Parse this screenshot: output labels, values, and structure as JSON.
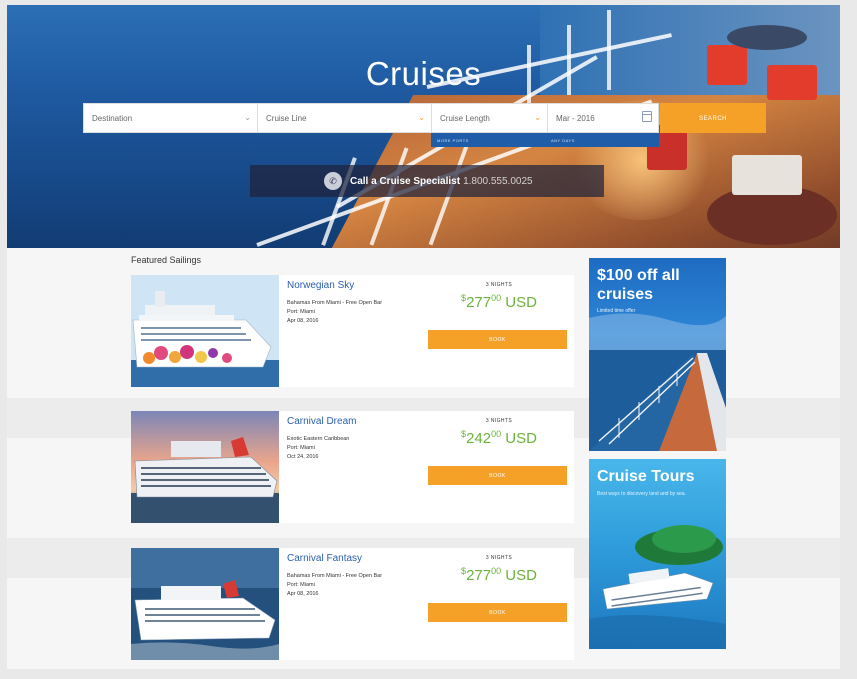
{
  "hero": {
    "title": "Cruises"
  },
  "search": {
    "destination_label": "Destination",
    "cruise_line_label": "Cruise Line",
    "cruise_length_label": "Cruise Length",
    "date_label": "Mar - 2016",
    "sublinks": [
      "MORE PORTS",
      "ANY DAYS"
    ],
    "button_label": "SEARCH"
  },
  "call": {
    "text": "Call a Cruise Specialist",
    "phone": "1.800.555.0025"
  },
  "featured": {
    "title": "Featured Sailings",
    "sailings": [
      {
        "name": "Norwegian Sky",
        "description": "Bahamas From Miami - Free Open Bar",
        "port": "Port: Miami",
        "date": "Apr 08, 2016",
        "nights": "3 NIGHTS",
        "price_dollars": "277",
        "price_cents": "00",
        "currency": "USD",
        "book_label": "BOOK"
      },
      {
        "name": "Carnival Dream",
        "description": "Exotic Eastern Caribbean",
        "port": "Port: Miami",
        "date": "Oct 24, 2016",
        "nights": "3 NIGHTS",
        "price_dollars": "242",
        "price_cents": "00",
        "currency": "USD",
        "book_label": "BOOK"
      },
      {
        "name": "Carnival Fantasy",
        "description": "Bahamas From Miami - Free Open Bar",
        "port": "Port: Miami",
        "date": "Apr 08, 2016",
        "nights": "3 NIGHTS",
        "price_dollars": "277",
        "price_cents": "00",
        "currency": "USD",
        "book_label": "BOOK"
      }
    ]
  },
  "ads": [
    {
      "headline": "$100 off all cruises",
      "subtext": "Limited time offer"
    },
    {
      "headline": "Cruise Tours",
      "subtext": "Best ways to discovery land and by sea."
    }
  ],
  "colors": {
    "accent_orange": "#f5a127",
    "price_green": "#6bb33d",
    "link_blue": "#2b5fad",
    "hero_blue": "#1f5aa1"
  },
  "icons": {
    "call": "phone-icon",
    "date": "calendar-icon",
    "dropdown": "chevron-down-icon"
  }
}
